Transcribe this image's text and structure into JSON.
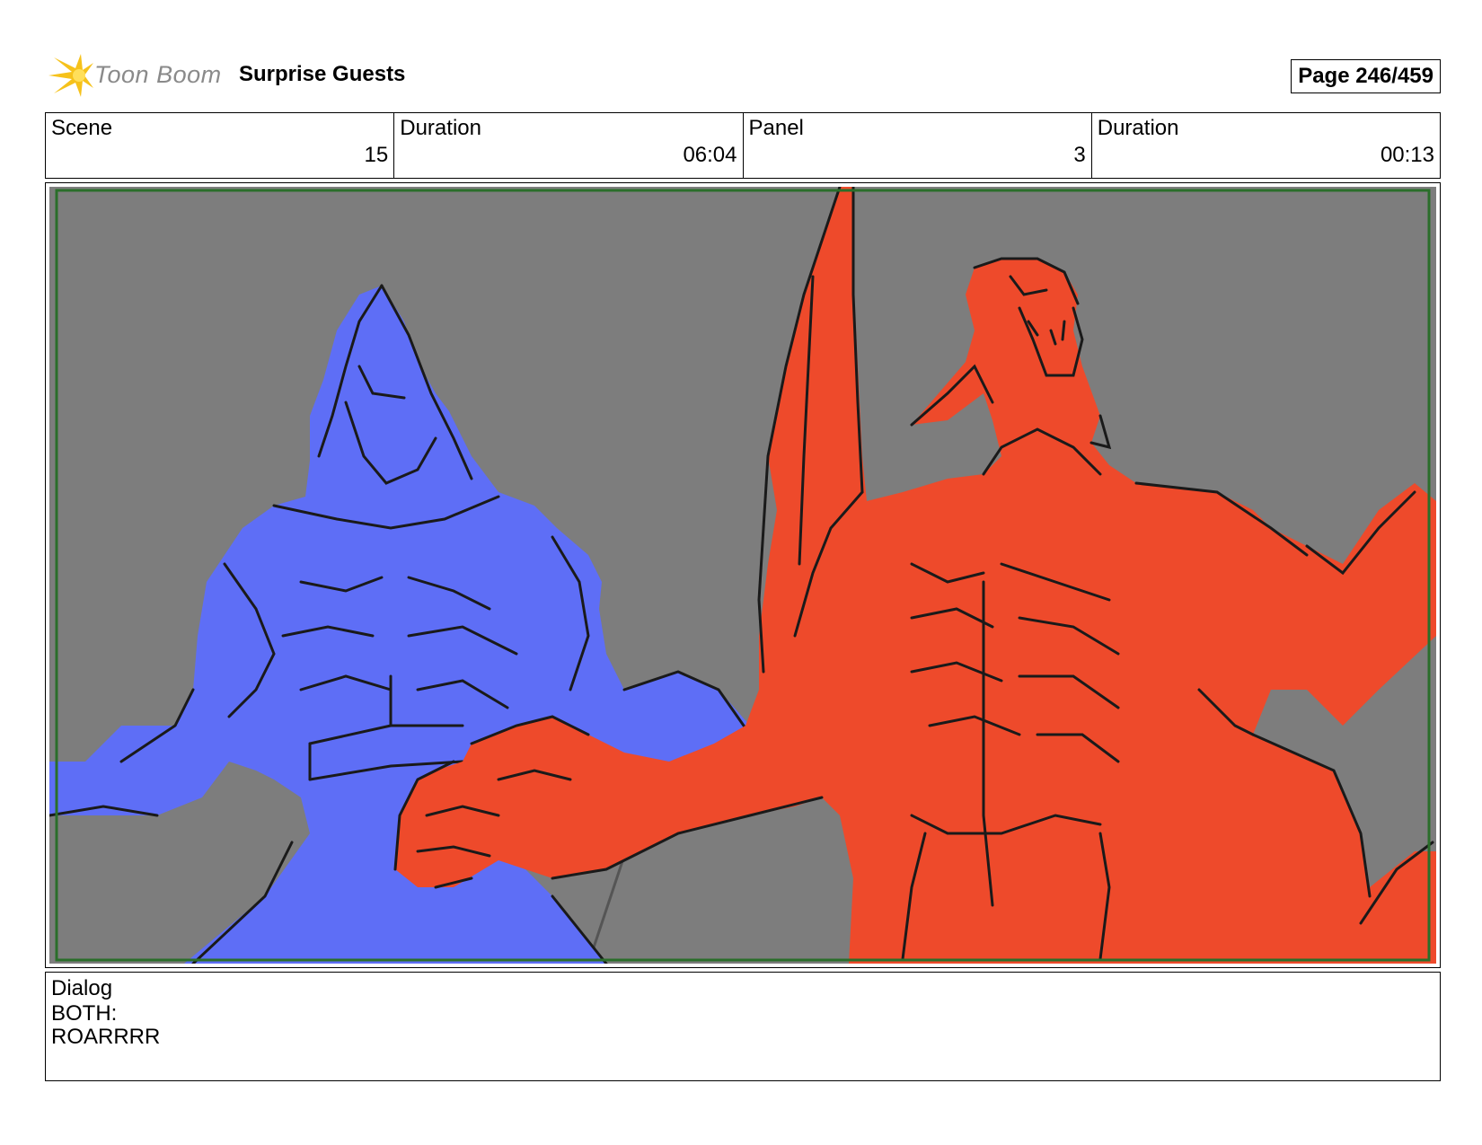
{
  "header": {
    "logo_text": "Toon Boom",
    "project_title": "Surprise Guests",
    "page_label": "Page 246/459"
  },
  "info": [
    {
      "label": "Scene",
      "value": "15"
    },
    {
      "label": "Duration",
      "value": "06:04"
    },
    {
      "label": "Panel",
      "value": "3"
    },
    {
      "label": "Duration",
      "value": "00:13"
    }
  ],
  "colors": {
    "background_gray": "#7d7d7d",
    "blue_creature": "#5e6ef6",
    "red_creature": "#ee4a2b",
    "safe_frame": "#2a6e2a"
  },
  "dialog": {
    "label": "Dialog",
    "lines": [
      "BOTH:",
      "ROARRRR"
    ]
  }
}
